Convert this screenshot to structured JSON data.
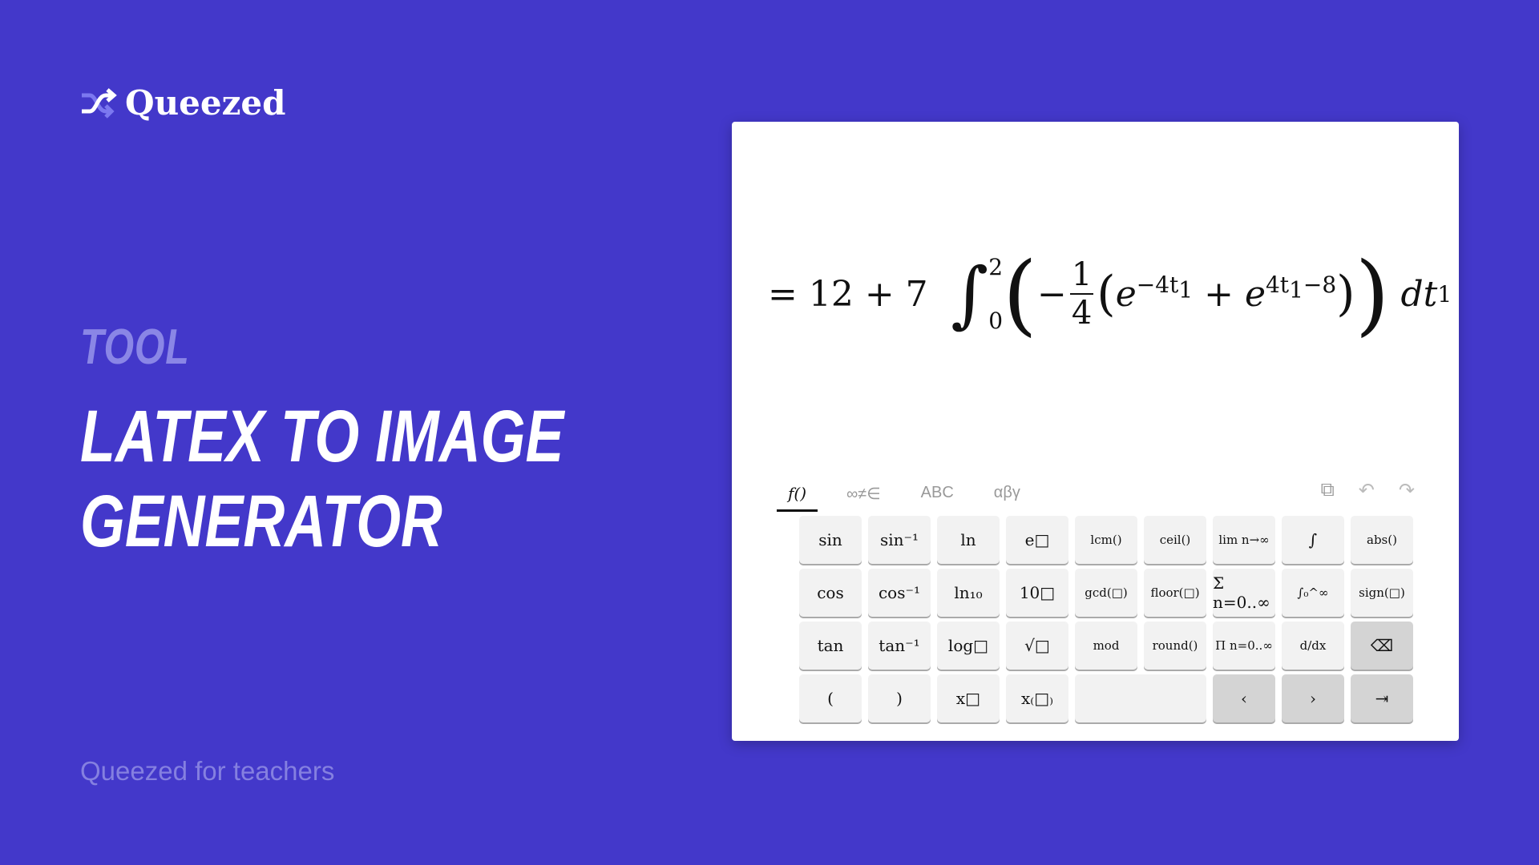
{
  "brand": {
    "name": "Queezed",
    "icon": "shuffle-icon",
    "accent": "#7c78f0"
  },
  "hero": {
    "kicker": "TOOL",
    "title": "LATEX TO IMAGE GENERATOR"
  },
  "footer": {
    "text": "Queezed for teachers"
  },
  "equation": {
    "latex": "= 12 + 7 \\int_0^2 \\left(-\\frac{1}{4}\\left(e^{-4t_1}+e^{4t_1-8}\\right)\\right) dt_1",
    "prefix": "= 12 + 7",
    "int_upper": "2",
    "int_lower": "0",
    "frac_num": "1",
    "frac_den": "4",
    "e1_exp": "−4t",
    "e2_exp": "4t",
    "e2_tail": "−8",
    "sub": "1",
    "dt": "dt"
  },
  "keyboard": {
    "tabs": [
      "f()",
      "∞≠∈",
      "ABC",
      "αβγ"
    ],
    "active_tab": "f()",
    "tools": [
      "copy-icon",
      "undo-icon",
      "redo-icon"
    ],
    "keys": [
      "sin",
      "sin⁻¹",
      "ln",
      "e□",
      "lcm()",
      "ceil()",
      "lim n→∞",
      "∫",
      "abs()",
      "cos",
      "cos⁻¹",
      "ln₁₀",
      "10□",
      "gcd(□)",
      "floor(□)",
      "Σ n=0..∞",
      "∫₀^∞",
      "sign(□)",
      "tan",
      "tan⁻¹",
      "log□",
      "√□",
      "mod",
      "round()",
      "Π n=0..∞",
      "d/dx",
      "⌫",
      "(",
      ")",
      "x□",
      "x₍□₎",
      "",
      "‹",
      "›",
      "⇥"
    ]
  }
}
